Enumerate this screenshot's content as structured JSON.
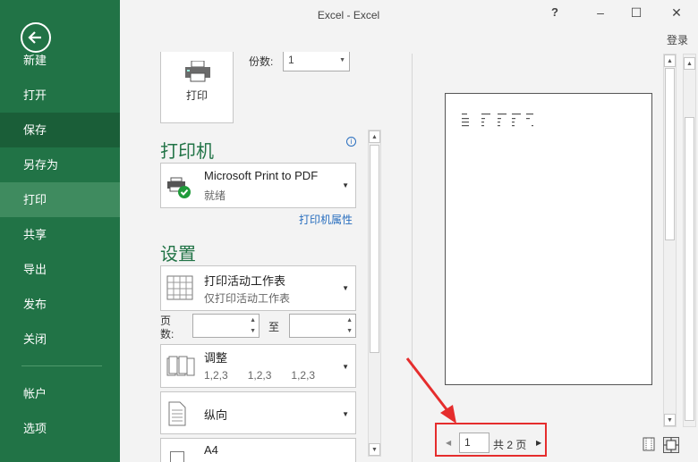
{
  "window": {
    "title": "Excel - Excel",
    "help": "?",
    "minimize": "–",
    "maximize": "☐",
    "close": "✕",
    "login": "登录"
  },
  "sidebar": {
    "items": [
      {
        "label": "新建"
      },
      {
        "label": "打开"
      },
      {
        "label": "保存"
      },
      {
        "label": "另存为"
      },
      {
        "label": "打印"
      },
      {
        "label": "共享"
      },
      {
        "label": "导出"
      },
      {
        "label": "发布"
      },
      {
        "label": "关闭"
      },
      {
        "label": "帐户"
      },
      {
        "label": "选项"
      }
    ]
  },
  "print": {
    "button_label": "打印",
    "copies_label": "份数:",
    "copies_value": "1"
  },
  "printer": {
    "section_title": "打印机",
    "name": "Microsoft Print to PDF",
    "status": "就绪",
    "properties_link": "打印机属性"
  },
  "settings": {
    "section_title": "设置",
    "scope_main": "打印活动工作表",
    "scope_sub": "仅打印活动工作表",
    "pages_label_1": "页",
    "pages_label_2": "数:",
    "to_label": "至",
    "pages_from": "",
    "pages_to": "",
    "collate_main": "调整",
    "collate_sub": [
      "1,2,3",
      "1,2,3",
      "1,2,3"
    ],
    "orientation": "纵向",
    "paper": "A4"
  },
  "preview": {
    "current_page": "1",
    "total_pages": "共 2 页"
  },
  "colors": {
    "accent": "#217346",
    "highlight": "#e52d2d",
    "link": "#2a6fbf"
  }
}
